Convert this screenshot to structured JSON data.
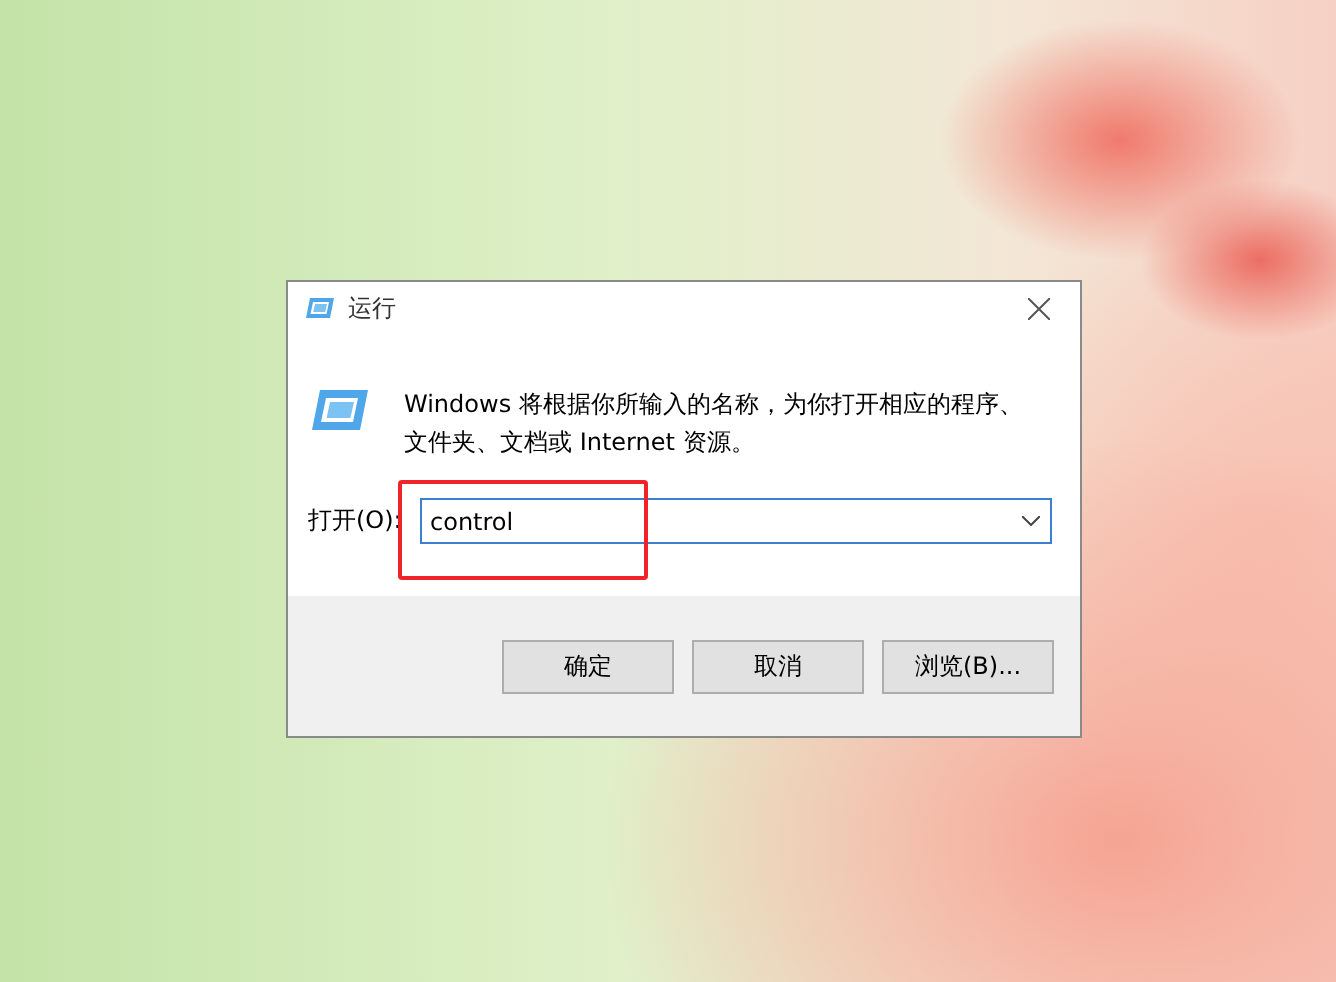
{
  "window": {
    "title": "运行"
  },
  "message": "Windows 将根据你所输入的名称，为你打开相应的程序、文件夹、文档或 Internet 资源。",
  "open_field": {
    "label": "打开(O):",
    "value": "control",
    "highlighted": true
  },
  "buttons": [
    "确定",
    "取消",
    "浏览(B)..."
  ]
}
